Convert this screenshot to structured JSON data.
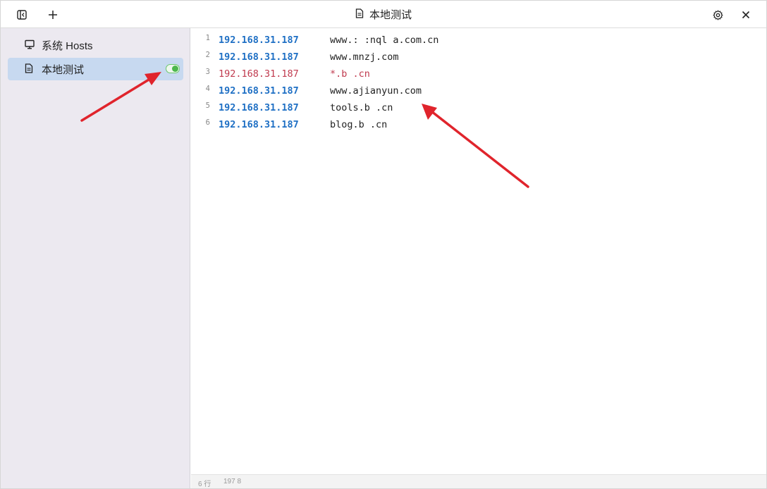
{
  "window": {
    "title": "本地测试",
    "title_icon": "file-icon"
  },
  "toolbar": {
    "sidebar_toggle_icon": "sidebar-toggle-icon",
    "add_icon": "plus-icon",
    "settings_icon": "gear-icon",
    "close_icon": "close-icon"
  },
  "sidebar": {
    "items": [
      {
        "label": "系统 Hosts",
        "icon": "monitor-icon",
        "active": false
      },
      {
        "label": "本地测试",
        "icon": "file-icon",
        "active": true,
        "enabled": true
      }
    ]
  },
  "editor": {
    "lines": [
      {
        "num": "1",
        "ip": "192.168.31.187",
        "host": "www.:      :nql    a.com.cn",
        "enabled": true
      },
      {
        "num": "2",
        "ip": "192.168.31.187",
        "host": "www.mnzj.com",
        "enabled": true
      },
      {
        "num": "3",
        "ip": "192.168.31.187",
        "host": "*.b    .cn",
        "enabled": false
      },
      {
        "num": "4",
        "ip": "192.168.31.187",
        "host": "www.ajianyun.com",
        "enabled": true
      },
      {
        "num": "5",
        "ip": "192.168.31.187",
        "host": "tools.b    .cn",
        "enabled": true
      },
      {
        "num": "6",
        "ip": "192.168.31.187",
        "host": "blog.b    .cn",
        "enabled": true
      }
    ]
  },
  "statusbar": {
    "lines": "6 行",
    "chars": "197 8"
  },
  "colors": {
    "ip_active": "#1e6fc4",
    "ip_disabled": "#c03a4e",
    "sidebar_bg": "#ece9f0",
    "active_item_bg": "#c7d9f0",
    "toggle_on": "#4cb84c",
    "annotation_arrow": "#e0242c"
  }
}
